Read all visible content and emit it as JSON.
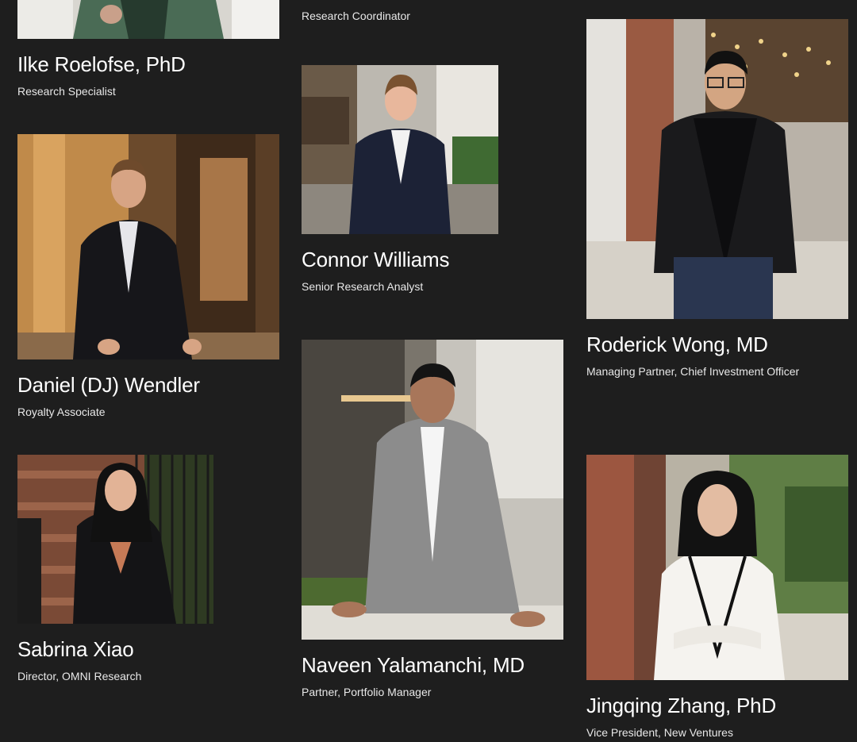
{
  "team": [
    {
      "name": "",
      "role": "Research Coordinator"
    },
    {
      "name": "Ilke Roelofse, PhD",
      "role": "Research Specialist"
    },
    {
      "name": "Daniel (DJ) Wendler",
      "role": "Royalty Associate"
    },
    {
      "name": "Sabrina Xiao",
      "role": "Director, OMNI Research"
    },
    {
      "name": "Connor Williams",
      "role": "Senior Research Analyst"
    },
    {
      "name": "Naveen Yalamanchi, MD",
      "role": "Partner, Portfolio Manager"
    },
    {
      "name": "Roderick Wong, MD",
      "role": "Managing Partner, Chief Investment Officer"
    },
    {
      "name": "Jingqing Zhang, PhD",
      "role": "Vice President, New Ventures"
    }
  ]
}
